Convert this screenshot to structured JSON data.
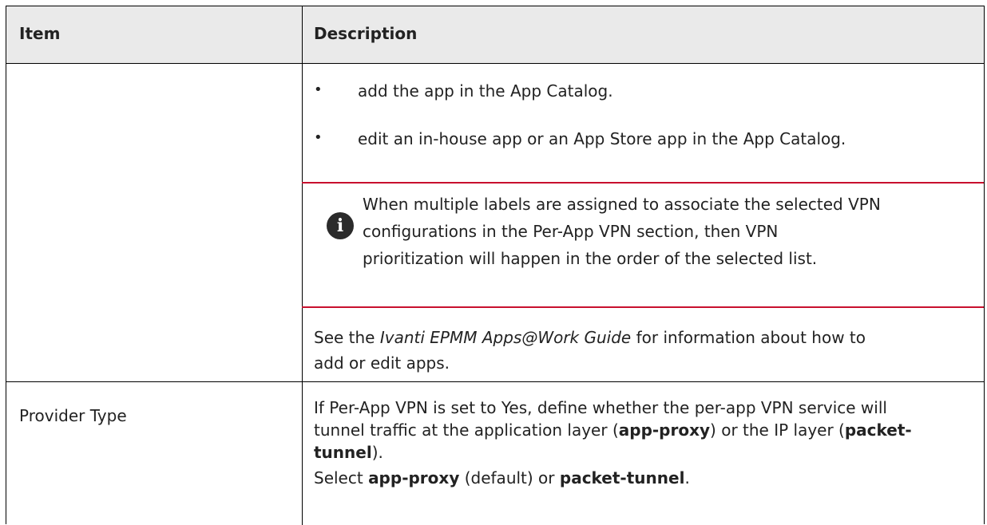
{
  "table": {
    "header": {
      "item": "Item",
      "description": "Description"
    },
    "row1": {
      "bullets": [
        "add the app in the App Catalog.",
        "edit an in-house app or an App Store app in the App Catalog."
      ],
      "note_icon": "info-icon",
      "note_lines": [
        "When multiple labels are assigned to associate the selected VPN",
        "configurations in the Per-App VPN section, then VPN",
        "prioritization will happen in the order of the selected list."
      ],
      "see_prefix": "See the ",
      "see_guide": "Ivanti EPMM Apps@Work Guide",
      "see_suffix_line1": " for information about how to",
      "see_line2": "add or edit apps."
    },
    "row2": {
      "item": "Provider Type",
      "desc_line1": "If Per-App VPN is set to Yes, define whether the per-app VPN service will",
      "desc_line2_a": "tunnel traffic at the application layer (",
      "desc_line2_b": "app-proxy",
      "desc_line2_c": ") or the IP layer (",
      "desc_line2_d": "packet-",
      "desc_line3_a": "tunnel",
      "desc_line3_b": ").",
      "select_a": "Select ",
      "select_b": "app-proxy",
      "select_c": " (default) or ",
      "select_d": "packet-tunnel",
      "select_e": "."
    },
    "colors": {
      "header_bg": "#eaeaea",
      "note_rule": "#c8102e",
      "text": "#222222"
    }
  }
}
